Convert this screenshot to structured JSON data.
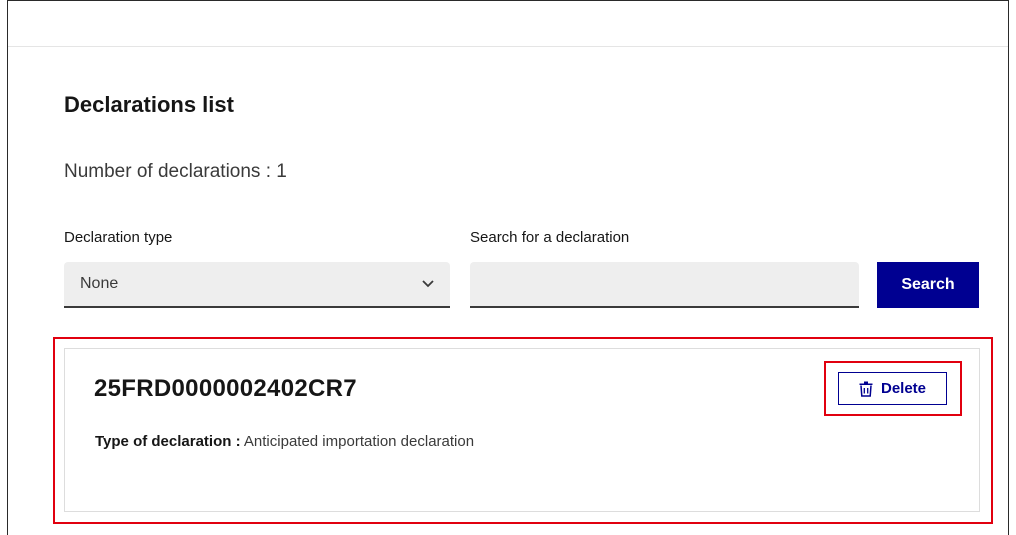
{
  "page": {
    "title": "Declarations list",
    "count_label": "Number of declarations : 1"
  },
  "filters": {
    "type_label": "Declaration type",
    "type_value": "None",
    "search_label": "Search for a declaration",
    "search_value": "",
    "search_placeholder": "",
    "search_button": "Search"
  },
  "declarations": [
    {
      "id": "25FRD0000002402CR7",
      "type_label": "Type of declaration :",
      "type_value": "Anticipated importation declaration",
      "delete_label": "Delete",
      "delete_icon": "trash-icon"
    }
  ],
  "colors": {
    "primary": "#000091",
    "highlight": "#e1000f"
  }
}
